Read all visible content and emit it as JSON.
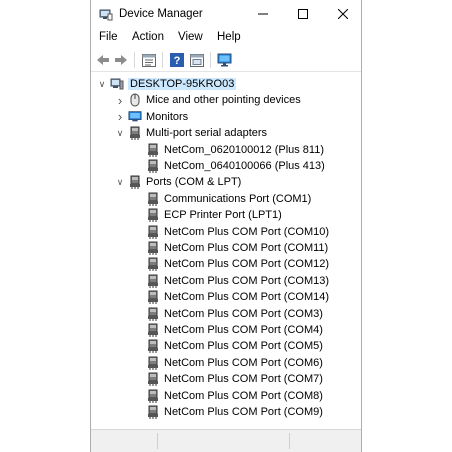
{
  "window": {
    "title": "Device Manager"
  },
  "menu": [
    "File",
    "Action",
    "View",
    "Help"
  ],
  "toolbar_icons": [
    "back-icon",
    "forward-icon",
    "properties-icon",
    "help-icon",
    "show-hidden-icon",
    "monitor-icon"
  ],
  "tree": {
    "root": "DESKTOP-95KRO03",
    "items": [
      {
        "label": "Mice and other pointing devices",
        "level": 1,
        "expander": "collapsed",
        "icon": "mouse-icon"
      },
      {
        "label": "Monitors",
        "level": 1,
        "expander": "collapsed",
        "icon": "monitor-icon"
      },
      {
        "label": "Multi-port serial adapters",
        "level": 1,
        "expander": "expanded",
        "icon": "port-icon"
      },
      {
        "label": "NetCom_0620100012 (Plus 811)",
        "level": 2,
        "expander": "none",
        "icon": "port-icon"
      },
      {
        "label": "NetCom_0640100066 (Plus 413)",
        "level": 2,
        "expander": "none",
        "icon": "port-icon"
      },
      {
        "label": "Ports (COM & LPT)",
        "level": 1,
        "expander": "expanded",
        "icon": "port-icon"
      },
      {
        "label": "Communications Port (COM1)",
        "level": 2,
        "expander": "none",
        "icon": "port-icon"
      },
      {
        "label": "ECP Printer Port (LPT1)",
        "level": 2,
        "expander": "none",
        "icon": "port-icon"
      },
      {
        "label": "NetCom Plus COM Port (COM10)",
        "level": 2,
        "expander": "none",
        "icon": "port-icon"
      },
      {
        "label": "NetCom Plus COM Port (COM11)",
        "level": 2,
        "expander": "none",
        "icon": "port-icon"
      },
      {
        "label": "NetCom Plus COM Port (COM12)",
        "level": 2,
        "expander": "none",
        "icon": "port-icon"
      },
      {
        "label": "NetCom Plus COM Port (COM13)",
        "level": 2,
        "expander": "none",
        "icon": "port-icon"
      },
      {
        "label": "NetCom Plus COM Port (COM14)",
        "level": 2,
        "expander": "none",
        "icon": "port-icon"
      },
      {
        "label": "NetCom Plus COM Port (COM3)",
        "level": 2,
        "expander": "none",
        "icon": "port-icon"
      },
      {
        "label": "NetCom Plus COM Port (COM4)",
        "level": 2,
        "expander": "none",
        "icon": "port-icon"
      },
      {
        "label": "NetCom Plus COM Port (COM5)",
        "level": 2,
        "expander": "none",
        "icon": "port-icon"
      },
      {
        "label": "NetCom Plus COM Port (COM6)",
        "level": 2,
        "expander": "none",
        "icon": "port-icon"
      },
      {
        "label": "NetCom Plus COM Port (COM7)",
        "level": 2,
        "expander": "none",
        "icon": "port-icon"
      },
      {
        "label": "NetCom Plus COM Port (COM8)",
        "level": 2,
        "expander": "none",
        "icon": "port-icon"
      },
      {
        "label": "NetCom Plus COM Port (COM9)",
        "level": 2,
        "expander": "none",
        "icon": "port-icon"
      }
    ]
  },
  "colors": {
    "selection": "#cce8ff",
    "accent": "#0078d7"
  }
}
